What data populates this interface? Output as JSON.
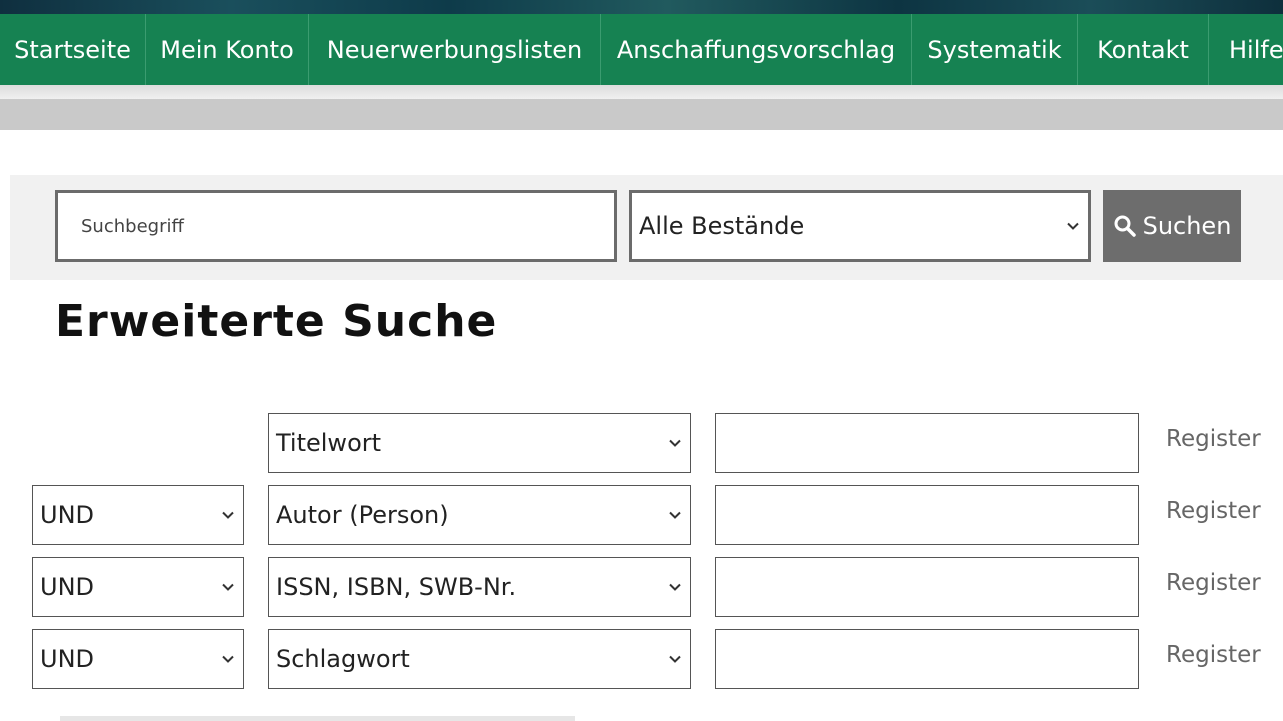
{
  "nav": {
    "items": [
      {
        "label": "Startseite"
      },
      {
        "label": "Mein Konto"
      },
      {
        "label": "Neuerwerbungslisten"
      },
      {
        "label": "Anschaffungsvorschlag"
      },
      {
        "label": "Systematik"
      },
      {
        "label": "Kontakt"
      },
      {
        "label": "Hilfe"
      }
    ]
  },
  "search": {
    "placeholder": "Suchbegriff",
    "scope_selected": "Alle Bestände",
    "button_label": "Suchen",
    "button_icon": "search-icon"
  },
  "advanced": {
    "title": "Erweiterte Suche",
    "rows": [
      {
        "operator": "",
        "field": "Titelwort",
        "value": "",
        "register_label": "Register"
      },
      {
        "operator": "UND",
        "field": "Autor (Person)",
        "value": "",
        "register_label": "Register"
      },
      {
        "operator": "UND",
        "field": "ISSN, ISBN, SWB-Nr.",
        "value": "",
        "register_label": "Register"
      },
      {
        "operator": "UND",
        "field": "Schlagwort",
        "value": "",
        "register_label": "Register"
      }
    ]
  },
  "colors": {
    "nav_green": "#168252",
    "search_button": "#6d6d6d",
    "panel_gray": "#f1f1f1"
  }
}
